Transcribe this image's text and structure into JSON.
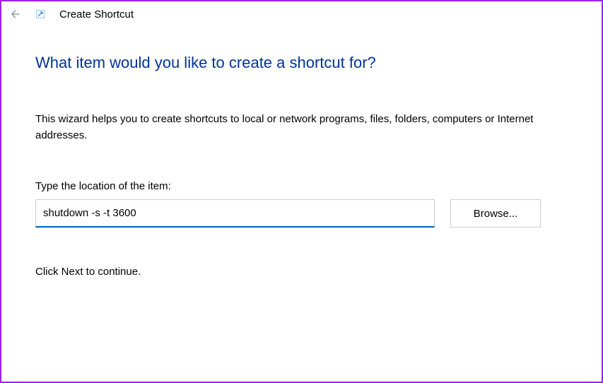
{
  "header": {
    "title": "Create Shortcut"
  },
  "content": {
    "heading": "What item would you like to create a shortcut for?",
    "description": "This wizard helps you to create shortcuts to local or network programs, files, folders, computers or Internet addresses.",
    "input_label": "Type the location of the item:",
    "input_value": "shutdown -s -t 3600",
    "browse_label": "Browse...",
    "continue_text": "Click Next to continue."
  }
}
